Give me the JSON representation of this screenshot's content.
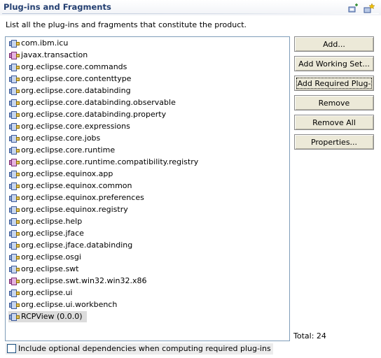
{
  "section": {
    "title": "Plug-ins and Fragments",
    "toolbar_icons": [
      "add-plugin-icon",
      "add-plugin-star-icon"
    ]
  },
  "description": "List all the plug-ins and fragments that constitute the product.",
  "plugins": [
    {
      "label": "com.ibm.icu",
      "type": "plugin"
    },
    {
      "label": "javax.transaction",
      "type": "fragment"
    },
    {
      "label": "org.eclipse.core.commands",
      "type": "plugin"
    },
    {
      "label": "org.eclipse.core.contenttype",
      "type": "plugin"
    },
    {
      "label": "org.eclipse.core.databinding",
      "type": "plugin"
    },
    {
      "label": "org.eclipse.core.databinding.observable",
      "type": "plugin"
    },
    {
      "label": "org.eclipse.core.databinding.property",
      "type": "plugin"
    },
    {
      "label": "org.eclipse.core.expressions",
      "type": "plugin"
    },
    {
      "label": "org.eclipse.core.jobs",
      "type": "plugin"
    },
    {
      "label": "org.eclipse.core.runtime",
      "type": "plugin"
    },
    {
      "label": "org.eclipse.core.runtime.compatibility.registry",
      "type": "fragment"
    },
    {
      "label": "org.eclipse.equinox.app",
      "type": "plugin"
    },
    {
      "label": "org.eclipse.equinox.common",
      "type": "plugin"
    },
    {
      "label": "org.eclipse.equinox.preferences",
      "type": "plugin"
    },
    {
      "label": "org.eclipse.equinox.registry",
      "type": "plugin"
    },
    {
      "label": "org.eclipse.help",
      "type": "plugin"
    },
    {
      "label": "org.eclipse.jface",
      "type": "plugin"
    },
    {
      "label": "org.eclipse.jface.databinding",
      "type": "plugin"
    },
    {
      "label": "org.eclipse.osgi",
      "type": "plugin"
    },
    {
      "label": "org.eclipse.swt",
      "type": "plugin"
    },
    {
      "label": "org.eclipse.swt.win32.win32.x86",
      "type": "fragment"
    },
    {
      "label": "org.eclipse.ui",
      "type": "plugin"
    },
    {
      "label": "org.eclipse.ui.workbench",
      "type": "plugin"
    },
    {
      "label": "RCPView (0.0.0)",
      "type": "plugin",
      "selected": true
    }
  ],
  "buttons": {
    "add": "Add...",
    "add_working_set": "Add Working Set...",
    "add_required": "Add Required Plug-ins",
    "remove": "Remove",
    "remove_all": "Remove All",
    "properties": "Properties..."
  },
  "total": "Total: 24",
  "checkbox": {
    "label": "Include optional dependencies when computing required plug-ins",
    "checked": false
  },
  "colors": {
    "title": "#223e70",
    "list_border": "#7f9db9",
    "button_face": "#ece9d8",
    "selection": "#dcdcdc"
  }
}
